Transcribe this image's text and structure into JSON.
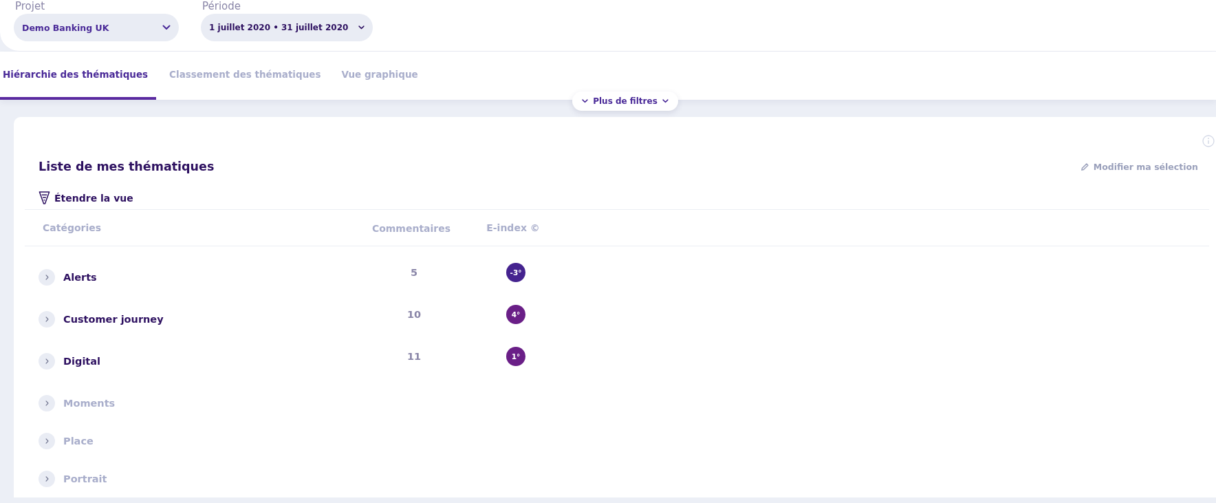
{
  "filters": [
    {
      "label": "Projet",
      "value": "Demo Banking UK"
    },
    {
      "label": "Période",
      "value": "1 juillet 2020 • 31 juillet 2020"
    }
  ],
  "tabs": [
    {
      "label": "Hiérarchie des thématiques",
      "selected": true
    },
    {
      "label": "Classement des thématiques",
      "selected": false
    },
    {
      "label": "Vue graphique",
      "selected": false
    }
  ],
  "more_filters": "Plus de filtres",
  "panel": {
    "title": "Liste de mes thématiques",
    "edit_link": "Modifier ma sélection",
    "expand_view": "Étendre la vue",
    "columns": [
      "Catégories",
      "Commentaires",
      "E-index ©"
    ],
    "rows": [
      {
        "name": "Alerts",
        "disabled": false,
        "comments": "5",
        "e_index": "-3°",
        "color": "#45238f"
      },
      {
        "name": "Customer journey",
        "disabled": false,
        "comments": "10",
        "e_index": "4°",
        "color": "#6a1f87"
      },
      {
        "name": "Digital",
        "disabled": false,
        "comments": "11",
        "e_index": "1°",
        "color": "#6a1f87"
      },
      {
        "name": "Moments",
        "disabled": true
      },
      {
        "name": "Place",
        "disabled": true
      },
      {
        "name": "Portrait",
        "disabled": true
      }
    ]
  }
}
